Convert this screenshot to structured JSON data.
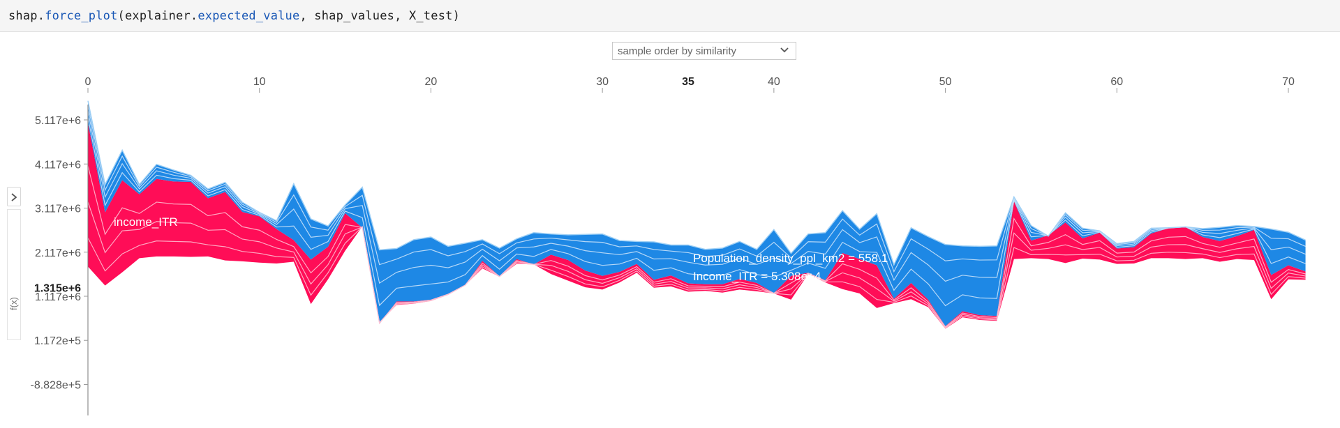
{
  "code": {
    "p1": "shap.",
    "p2": "force_plot",
    "p3": "(explainer.",
    "p4": "expected_value",
    "p5": ", shap_values, X_test)"
  },
  "controls": {
    "order_label": "sample order by similarity",
    "fx_label": "f(x)"
  },
  "colors": {
    "positive": "#ff0d57",
    "negative": "#1e88e5",
    "positive_line": "#ffc3d5",
    "negative_line": "#d1e6fa"
  },
  "chart_data": {
    "type": "area",
    "title": "",
    "xlabel": "",
    "ylabel": "f(x)",
    "x_ticks": [
      0,
      10,
      20,
      30,
      40,
      50,
      60,
      70
    ],
    "x_highlight": 35,
    "x_highlight_label": "35",
    "x_range": [
      0,
      71
    ],
    "y_ticks": [
      5117000,
      4117000,
      3117000,
      2117000,
      1117000,
      117200,
      -882800
    ],
    "y_tick_labels": [
      "5.117e+6",
      "4.117e+6",
      "3.117e+6",
      "2.117e+6",
      "1.117e+6",
      "1.172e+5",
      "-8.828e+5"
    ],
    "y_highlight": 1315000,
    "y_highlight_label": "1.315e+6",
    "y_range": [
      -1400000,
      5800000
    ],
    "labels": {
      "income_label": "income_ITR",
      "annotation_1": "Population_density_ppl_km2 = 558.1",
      "annotation_2": "Income_ITR = 5.308e+4"
    },
    "x": [
      0,
      1,
      2,
      3,
      4,
      5,
      6,
      7,
      8,
      9,
      10,
      11,
      12,
      13,
      14,
      15,
      16,
      17,
      18,
      19,
      20,
      21,
      22,
      23,
      24,
      25,
      26,
      27,
      28,
      29,
      30,
      31,
      32,
      33,
      34,
      35,
      36,
      37,
      38,
      39,
      40,
      41,
      42,
      43,
      44,
      45,
      46,
      47,
      48,
      49,
      50,
      51,
      52,
      53,
      54,
      55,
      56,
      57,
      58,
      59,
      60,
      61,
      62,
      63,
      64,
      65,
      66,
      67,
      68,
      69,
      70,
      71
    ],
    "series": [
      {
        "name": "f(x)",
        "values": [
          5050000,
          3020000,
          3750000,
          3430000,
          3780000,
          3720000,
          3710000,
          3340000,
          3480000,
          3030000,
          2930000,
          2640000,
          2390000,
          1950000,
          2240000,
          3000000,
          2670000,
          490000,
          1000000,
          1000000,
          1040000,
          1170000,
          1370000,
          1920000,
          1570000,
          1960000,
          1840000,
          2060000,
          1940000,
          1700000,
          1580000,
          1670000,
          1850000,
          1490000,
          1590000,
          1410000,
          1390000,
          1390000,
          1510000,
          1420000,
          1190000,
          1580000,
          1650000,
          1480000,
          2100000,
          1960000,
          1820000,
          1060000,
          1420000,
          1040000,
          440000,
          780000,
          690000,
          670000,
          3270000,
          2380000,
          2500000,
          2790000,
          2430000,
          2560000,
          2200000,
          2230000,
          2540000,
          2660000,
          2690000,
          2460000,
          2370000,
          2480000,
          2620000,
          1600000,
          1820000,
          1680000
        ]
      },
      {
        "name": "upper",
        "values": [
          5550000,
          3650000,
          4430000,
          3650000,
          4110000,
          3980000,
          3860000,
          3550000,
          3700000,
          3250000,
          3020000,
          2830000,
          3670000,
          2870000,
          2710000,
          3190000,
          3590000,
          2170000,
          2200000,
          2400000,
          2460000,
          2250000,
          2320000,
          2400000,
          2210000,
          2420000,
          2560000,
          2530000,
          2510000,
          2520000,
          2530000,
          2380000,
          2360000,
          2350000,
          2280000,
          2280000,
          2180000,
          2210000,
          2360000,
          2180000,
          2630000,
          2090000,
          2530000,
          2560000,
          3060000,
          2640000,
          2990000,
          1830000,
          2670000,
          2470000,
          2290000,
          2260000,
          2250000,
          2260000,
          3370000,
          2720000,
          2480000,
          3010000,
          2660000,
          2600000,
          2310000,
          2360000,
          2660000,
          2670000,
          2690000,
          2650000,
          2680000,
          2720000,
          2700000,
          2640000,
          2570000,
          2390000
        ]
      },
      {
        "name": "lower",
        "values": [
          1790000,
          1360000,
          1660000,
          1980000,
          2020000,
          2020000,
          2010000,
          2020000,
          1930000,
          1910000,
          1880000,
          1860000,
          1900000,
          940000,
          1500000,
          2150000,
          2700000,
          530000,
          920000,
          950000,
          1010000,
          1150000,
          1370000,
          1750000,
          1560000,
          1850000,
          1840000,
          1620000,
          1470000,
          1320000,
          1270000,
          1430000,
          1650000,
          1310000,
          1340000,
          1220000,
          1240000,
          1200000,
          1270000,
          1230000,
          1180000,
          1040000,
          1620000,
          1430000,
          1280000,
          1180000,
          850000,
          960000,
          1050000,
          870000,
          380000,
          640000,
          580000,
          560000,
          1960000,
          1980000,
          1960000,
          1870000,
          1970000,
          1950000,
          1850000,
          1860000,
          1980000,
          1980000,
          1960000,
          1980000,
          1900000,
          1960000,
          1940000,
          1050000,
          1500000,
          1490000
        ]
      }
    ]
  }
}
